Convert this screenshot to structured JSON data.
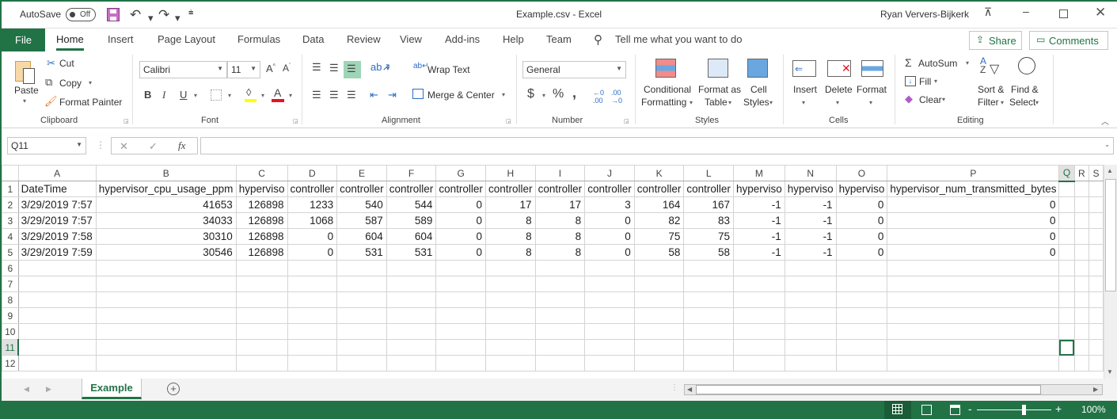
{
  "title_bar": {
    "autosave_label": "AutoSave",
    "autosave_state": "Off",
    "window_title": "Example.csv  -  Excel",
    "user_name": "Ryan Ververs-Bijkerk"
  },
  "menu_tabs": [
    "File",
    "Home",
    "Insert",
    "Page Layout",
    "Formulas",
    "Data",
    "Review",
    "View",
    "Add-ins",
    "Help",
    "Team"
  ],
  "tell_me_placeholder": "Tell me what you want to do",
  "share_label": "Share",
  "comments_label": "Comments",
  "ribbon": {
    "clipboard": {
      "paste": "Paste",
      "cut": "Cut",
      "copy": "Copy",
      "format_painter": "Format Painter",
      "label": "Clipboard"
    },
    "font": {
      "font_name": "Calibri",
      "font_size": "11",
      "bold": "B",
      "italic": "I",
      "underline": "U",
      "label": "Font"
    },
    "alignment": {
      "wrap_text": "Wrap Text",
      "merge_center": "Merge & Center",
      "label": "Alignment"
    },
    "number": {
      "format": "General",
      "currency": "$",
      "percent": "%",
      "comma": ",",
      "label": "Number"
    },
    "styles": {
      "conditional": "Conditional",
      "conditional2": "Formatting",
      "format_table": "Format as",
      "format_table2": "Table",
      "cell_styles": "Cell",
      "cell_styles2": "Styles",
      "label": "Styles"
    },
    "cells": {
      "insert": "Insert",
      "delete": "Delete",
      "format": "Format",
      "label": "Cells"
    },
    "editing": {
      "autosum": "AutoSum",
      "fill": "Fill",
      "clear": "Clear",
      "sort": "Sort &",
      "sort2": "Filter",
      "find": "Find &",
      "find2": "Select",
      "label": "Editing"
    }
  },
  "formula_bar": {
    "name_box": "Q11",
    "formula": "",
    "fx": "fx"
  },
  "columns": [
    "A",
    "B",
    "C",
    "D",
    "E",
    "F",
    "G",
    "H",
    "I",
    "J",
    "K",
    "L",
    "M",
    "N",
    "O",
    "P",
    "Q",
    "R",
    "S"
  ],
  "selected_column": "Q",
  "selected_row": 11,
  "rows": [
    {
      "n": "1",
      "cells": [
        "DateTime",
        "hypervisor_cpu_usage_ppm",
        "hyperviso",
        "controller",
        "controller",
        "controller",
        "controller",
        "controller",
        "controller",
        "controller",
        "controller",
        "controller",
        "hyperviso",
        "hyperviso",
        "hyperviso",
        "hypervisor_num_transmitted_bytes",
        "",
        "",
        ""
      ]
    },
    {
      "n": "2",
      "cells": [
        "3/29/2019 7:57",
        "41653",
        "126898",
        "1233",
        "540",
        "544",
        "0",
        "17",
        "17",
        "3",
        "164",
        "167",
        "-1",
        "-1",
        "0",
        "0",
        "",
        "",
        ""
      ]
    },
    {
      "n": "3",
      "cells": [
        "3/29/2019 7:57",
        "34033",
        "126898",
        "1068",
        "587",
        "589",
        "0",
        "8",
        "8",
        "0",
        "82",
        "83",
        "-1",
        "-1",
        "0",
        "0",
        "",
        "",
        ""
      ]
    },
    {
      "n": "4",
      "cells": [
        "3/29/2019 7:58",
        "30310",
        "126898",
        "0",
        "604",
        "604",
        "0",
        "8",
        "8",
        "0",
        "75",
        "75",
        "-1",
        "-1",
        "0",
        "0",
        "",
        "",
        ""
      ]
    },
    {
      "n": "5",
      "cells": [
        "3/29/2019 7:59",
        "30546",
        "126898",
        "0",
        "531",
        "531",
        "0",
        "8",
        "8",
        "0",
        "58",
        "58",
        "-1",
        "-1",
        "0",
        "0",
        "",
        "",
        ""
      ]
    },
    {
      "n": "6",
      "cells": [
        "",
        "",
        "",
        "",
        "",
        "",
        "",
        "",
        "",
        "",
        "",
        "",
        "",
        "",
        "",
        "",
        "",
        "",
        ""
      ]
    },
    {
      "n": "7",
      "cells": [
        "",
        "",
        "",
        "",
        "",
        "",
        "",
        "",
        "",
        "",
        "",
        "",
        "",
        "",
        "",
        "",
        "",
        "",
        ""
      ]
    },
    {
      "n": "8",
      "cells": [
        "",
        "",
        "",
        "",
        "",
        "",
        "",
        "",
        "",
        "",
        "",
        "",
        "",
        "",
        "",
        "",
        "",
        "",
        ""
      ]
    },
    {
      "n": "9",
      "cells": [
        "",
        "",
        "",
        "",
        "",
        "",
        "",
        "",
        "",
        "",
        "",
        "",
        "",
        "",
        "",
        "",
        "",
        "",
        ""
      ]
    },
    {
      "n": "10",
      "cells": [
        "",
        "",
        "",
        "",
        "",
        "",
        "",
        "",
        "",
        "",
        "",
        "",
        "",
        "",
        "",
        "",
        "",
        "",
        ""
      ]
    },
    {
      "n": "11",
      "cells": [
        "",
        "",
        "",
        "",
        "",
        "",
        "",
        "",
        "",
        "",
        "",
        "",
        "",
        "",
        "",
        "",
        "",
        "",
        ""
      ]
    },
    {
      "n": "12",
      "cells": [
        "",
        "",
        "",
        "",
        "",
        "",
        "",
        "",
        "",
        "",
        "",
        "",
        "",
        "",
        "",
        "",
        "",
        "",
        ""
      ]
    }
  ],
  "sheet_tabs": [
    "Example"
  ],
  "status_bar": {
    "zoom": "100%"
  },
  "colors": {
    "accent": "#217346"
  }
}
